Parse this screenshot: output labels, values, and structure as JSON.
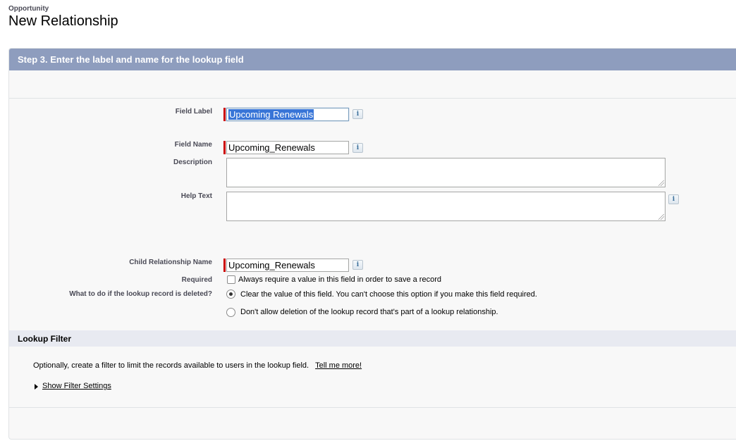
{
  "header": {
    "object_name": "Opportunity",
    "title": "New Relationship"
  },
  "step": {
    "title": "Step 3. Enter the label and name for the lookup field"
  },
  "fields": {
    "field_label": {
      "label": "Field Label",
      "value": "Upcoming Renewals"
    },
    "field_name": {
      "label": "Field Name",
      "value": "Upcoming_Renewals"
    },
    "description": {
      "label": "Description",
      "value": ""
    },
    "help_text": {
      "label": "Help Text",
      "value": ""
    },
    "child_relationship_name": {
      "label": "Child Relationship Name",
      "value": "Upcoming_Renewals"
    },
    "required": {
      "label": "Required",
      "checked": false,
      "option_text": "Always require a value in this field in order to save a record"
    },
    "delete_behavior": {
      "label": "What to do if the lookup record is deleted?",
      "options": [
        {
          "text": "Clear the value of this field. You can't choose this option if you make this field required.",
          "selected": true
        },
        {
          "text": "Don't allow deletion of the lookup record that's part of a lookup relationship.",
          "selected": false
        }
      ]
    }
  },
  "info_icon_glyph": "i",
  "lookup_filter": {
    "title": "Lookup Filter",
    "description": "Optionally, create a filter to limit the records available to users in the lookup field.",
    "tell_me_more": "Tell me more!",
    "show_settings": "Show Filter Settings"
  },
  "colors": {
    "step_header_bg": "#8e9dbe",
    "required_bar": "#cc0000",
    "selection": "#3875d7"
  }
}
